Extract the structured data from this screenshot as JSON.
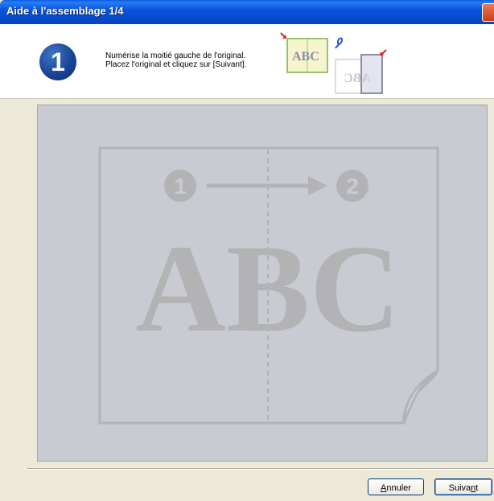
{
  "window": {
    "title": "Aide à l'assemblage 1/4"
  },
  "header": {
    "step_number": "1",
    "instructions": [
      "Numérise la moitié gauche de l'original.",
      "Placez l'original et cliquez sur [Suivant]."
    ],
    "mini_diagram": {
      "front_text": "ABC",
      "back_text": "ABC"
    }
  },
  "preview": {
    "big_text": "ABC",
    "step_a": "1",
    "step_b": "2"
  },
  "buttons": {
    "cancel": {
      "first": "A",
      "rest": "nnuler"
    },
    "next": {
      "before": "Suiva",
      "underlined": "n",
      "after": "t"
    }
  },
  "colors": {
    "titlebar": "#0855dd",
    "step_circle": "#1a4596",
    "preview_bg": "#c9cbd3",
    "preview_ink": "#b3b3b6",
    "arrow_red": "#d8251a"
  }
}
